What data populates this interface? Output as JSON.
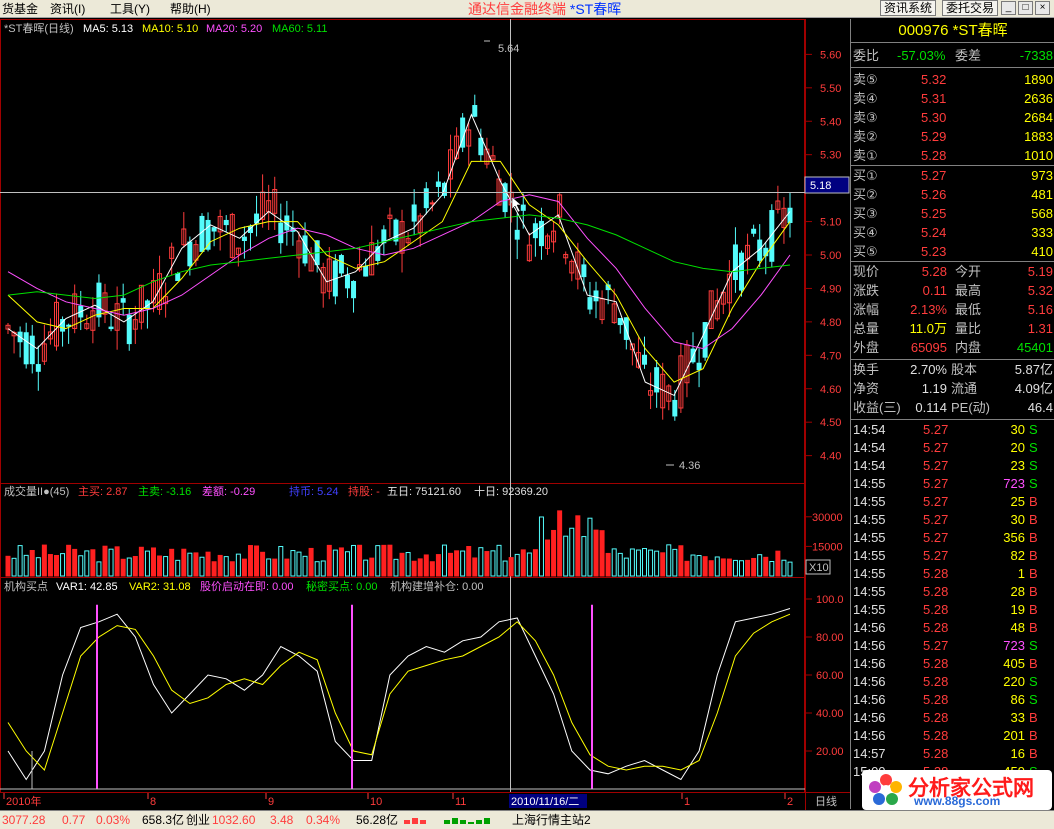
{
  "menu": [
    "货基金",
    "资讯(I)",
    "工具(Y)",
    "帮助(H)"
  ],
  "app_title": "通达信金融终端",
  "app_stock": "*ST春晖",
  "top_buttons": [
    "资讯系统",
    "委托交易"
  ],
  "window_buttons": [
    "_",
    "□",
    "×"
  ],
  "main_chart": {
    "header": {
      "name": "*ST春晖(日线)",
      "ma5": "MA5: 5.13",
      "ma10": "MA10: 5.10",
      "ma20": "MA20: 5.20",
      "ma60": "MA60: 5.11"
    },
    "y_ticks": [
      "5.60",
      "5.50",
      "5.40",
      "5.30",
      "5.20",
      "5.10",
      "5.00",
      "4.90",
      "4.80",
      "4.70",
      "4.60",
      "4.50",
      "4.40"
    ],
    "high_label": "5.64",
    "low_label": "4.36",
    "crosshair_price": "5.18",
    "ylim": [
      4.36,
      5.64
    ]
  },
  "volume": {
    "header": {
      "name": "成交量II●(45)",
      "zhumai": "主买: 2.87",
      "zhumai2": "主卖: -3.16",
      "diff": "差额: -0.29",
      "holdnum": "持币: 5.24",
      "holdstock": "持股: -",
      "d5": "五日: 75121.60",
      "d10": "十日: 92369.20"
    },
    "y_ticks": [
      "30000",
      "15000"
    ],
    "unit": "X10"
  },
  "indicator": {
    "header": {
      "name": "机构买点",
      "var1": "VAR1: 42.85",
      "var2": "VAR2: 31.08",
      "start": "股价启动在即: 0.00",
      "secret": "秘密买点: 0.00",
      "build": "机构建增补仓: 0.00"
    },
    "y_ticks": [
      "100.0",
      "80.00",
      "60.00",
      "40.00",
      "20.00"
    ]
  },
  "date_axis": {
    "labels": [
      "2010年",
      "8",
      "9",
      "10",
      "11",
      "1",
      "2"
    ],
    "crosshair_date": "2010/11/16/二",
    "period": "日线"
  },
  "right_panel": {
    "code_title": "000976 *ST春晖",
    "weibi": {
      "l1": "委比",
      "v1": "-57.03%",
      "l2": "委差",
      "v2": "-7338"
    },
    "sells": [
      {
        "label": "卖⑤",
        "price": "5.32",
        "vol": "1890"
      },
      {
        "label": "卖④",
        "price": "5.31",
        "vol": "2636"
      },
      {
        "label": "卖③",
        "price": "5.30",
        "vol": "2684"
      },
      {
        "label": "卖②",
        "price": "5.29",
        "vol": "1883"
      },
      {
        "label": "卖①",
        "price": "5.28",
        "vol": "1010"
      }
    ],
    "buys": [
      {
        "label": "买①",
        "price": "5.27",
        "vol": "973"
      },
      {
        "label": "买②",
        "price": "5.26",
        "vol": "481"
      },
      {
        "label": "买③",
        "price": "5.25",
        "vol": "568"
      },
      {
        "label": "买④",
        "price": "5.24",
        "vol": "333"
      },
      {
        "label": "买⑤",
        "price": "5.23",
        "vol": "410"
      }
    ],
    "quote": [
      {
        "l1": "现价",
        "v1": "5.28",
        "l2": "今开",
        "v2": "5.19"
      },
      {
        "l1": "涨跌",
        "v1": "0.11",
        "l2": "最高",
        "v2": "5.32"
      },
      {
        "l1": "涨幅",
        "v1": "2.13%",
        "l2": "最低",
        "v2": "5.16"
      },
      {
        "l1": "总量",
        "v1": "11.0万",
        "l2": "量比",
        "v2": "1.31"
      },
      {
        "l1": "外盘",
        "v1": "65095",
        "l2": "内盘",
        "v2": "45401"
      }
    ],
    "fund": [
      {
        "l1": "换手",
        "v1": "2.70%",
        "l2": "股本",
        "v2": "5.87亿"
      },
      {
        "l1": "净资",
        "v1": "1.19",
        "l2": "流通",
        "v2": "4.09亿"
      },
      {
        "l1": "收益(三)",
        "v1": "0.114",
        "l2": "PE(动)",
        "v2": "46.4"
      }
    ],
    "ticks": [
      {
        "t": "14:54",
        "p": "5.27",
        "v": "30",
        "s": "S"
      },
      {
        "t": "14:54",
        "p": "5.27",
        "v": "20",
        "s": "S"
      },
      {
        "t": "14:54",
        "p": "5.27",
        "v": "23",
        "s": "S"
      },
      {
        "t": "14:55",
        "p": "5.27",
        "v": "723",
        "s": "S"
      },
      {
        "t": "14:55",
        "p": "5.27",
        "v": "25",
        "s": "B"
      },
      {
        "t": "14:55",
        "p": "5.27",
        "v": "30",
        "s": "B"
      },
      {
        "t": "14:55",
        "p": "5.27",
        "v": "356",
        "s": "B"
      },
      {
        "t": "14:55",
        "p": "5.27",
        "v": "82",
        "s": "B"
      },
      {
        "t": "14:55",
        "p": "5.28",
        "v": "1",
        "s": "B"
      },
      {
        "t": "14:55",
        "p": "5.28",
        "v": "28",
        "s": "B"
      },
      {
        "t": "14:55",
        "p": "5.28",
        "v": "19",
        "s": "B"
      },
      {
        "t": "14:56",
        "p": "5.28",
        "v": "48",
        "s": "B"
      },
      {
        "t": "14:56",
        "p": "5.27",
        "v": "723",
        "s": "S"
      },
      {
        "t": "14:56",
        "p": "5.28",
        "v": "405",
        "s": "B"
      },
      {
        "t": "14:56",
        "p": "5.28",
        "v": "220",
        "s": "S"
      },
      {
        "t": "14:56",
        "p": "5.28",
        "v": "86",
        "s": "S"
      },
      {
        "t": "14:56",
        "p": "5.28",
        "v": "33",
        "s": "B"
      },
      {
        "t": "14:56",
        "p": "5.28",
        "v": "201",
        "s": "B"
      },
      {
        "t": "14:57",
        "p": "5.28",
        "v": "16",
        "s": "B"
      },
      {
        "t": "15:00",
        "p": "5.28",
        "v": "459",
        "s": "S"
      }
    ]
  },
  "status_bar": {
    "index1": "3077.28",
    "chg1": "0.77",
    "pct1": "0.03%",
    "amt1": "658.3亿",
    "name2": "创业",
    "index2": "1032.60",
    "chg2": "3.48",
    "pct2": "0.34%",
    "amt2": "56.28亿",
    "station": "上海行情主站2"
  },
  "logo": {
    "text": "分析家公式网",
    "url": "www.88gs.com"
  },
  "colors": {
    "up": "#ff3c3c",
    "down": "#54fcfc",
    "ma5": "#ffffff",
    "ma10": "#ffff00",
    "ma20": "#ff50ff",
    "ma60": "#00e000",
    "grid": "#900000"
  },
  "chart_data": {
    "type": "line",
    "title": "*ST春晖(日线)",
    "series": [
      {
        "name": "MA5",
        "values": [
          4.78,
          4.72,
          4.81,
          4.85,
          4.8,
          4.86,
          5.02,
          5.09,
          5.05,
          5.13,
          5.07,
          4.92,
          4.95,
          5.04,
          5.08,
          5.18,
          5.42,
          5.22,
          5.06,
          5.12,
          4.88,
          4.86,
          4.62,
          4.58,
          4.76,
          4.95,
          5.02,
          5.13
        ]
      },
      {
        "name": "MA10",
        "values": [
          4.88,
          4.8,
          4.78,
          4.82,
          4.84,
          4.84,
          4.93,
          5.04,
          5.08,
          5.1,
          5.1,
          5.0,
          4.96,
          4.98,
          5.04,
          5.1,
          5.28,
          5.28,
          5.15,
          5.09,
          4.98,
          4.88,
          4.72,
          4.62,
          4.66,
          4.84,
          4.98,
          5.1
        ]
      },
      {
        "name": "MA20",
        "values": [
          4.95,
          4.9,
          4.86,
          4.84,
          4.82,
          4.84,
          4.88,
          4.94,
          5.0,
          5.05,
          5.08,
          5.06,
          5.02,
          5.0,
          5.02,
          5.06,
          5.1,
          5.16,
          5.18,
          5.16,
          5.05,
          4.96,
          4.84,
          4.74,
          4.72,
          4.78,
          4.88,
          5.0
        ]
      },
      {
        "name": "MA60",
        "values": [
          4.88,
          4.89,
          4.88,
          4.87,
          4.88,
          4.92,
          4.95,
          4.97,
          4.98,
          4.99,
          5.0,
          5.01,
          5.02,
          5.04,
          5.06,
          5.08,
          5.1,
          5.11,
          5.12,
          5.11,
          5.09,
          5.06,
          5.02,
          4.98,
          4.96,
          4.95,
          4.96,
          4.97
        ]
      }
    ],
    "ylim": [
      4.36,
      5.64
    ],
    "ylabel": "",
    "xlabel": ""
  }
}
